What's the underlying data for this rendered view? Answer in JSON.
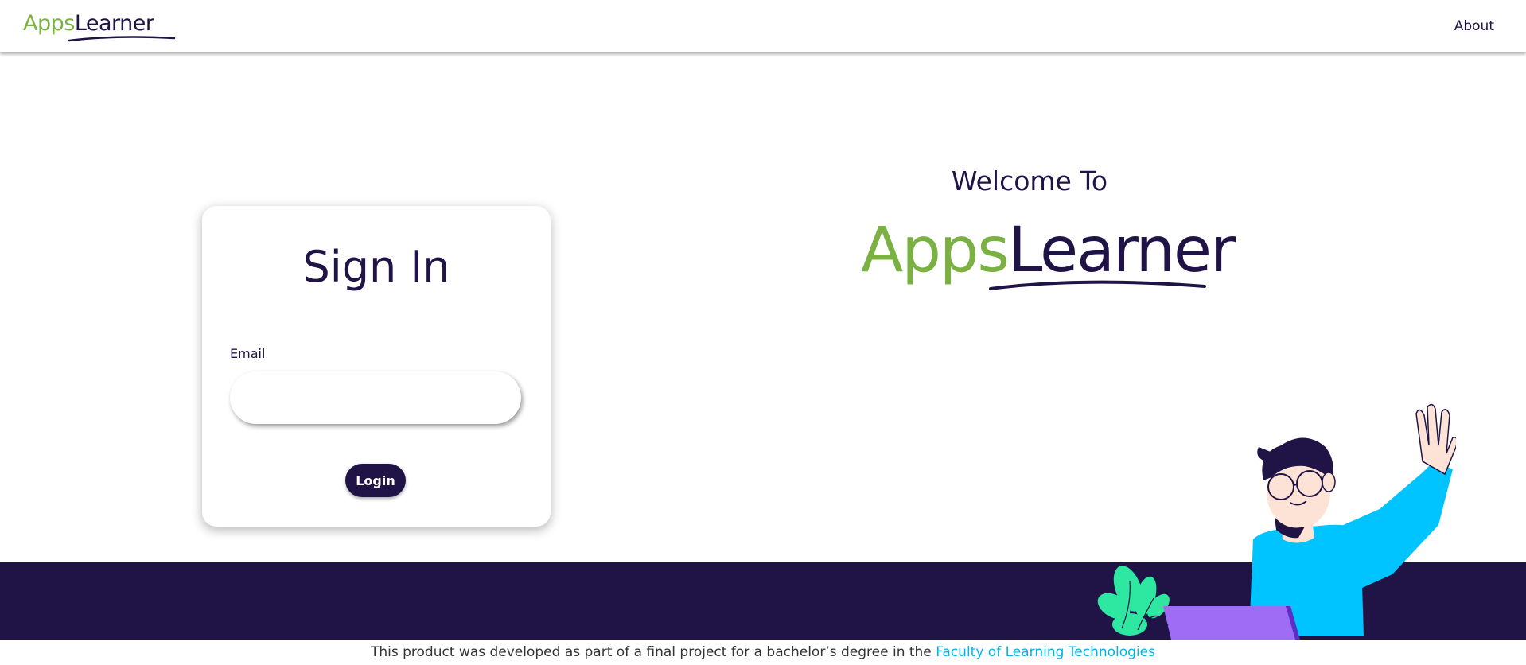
{
  "header": {
    "logo": {
      "part1": "Apps",
      "part2": "Learner"
    },
    "nav": {
      "about_label": "About"
    }
  },
  "signin": {
    "title": "Sign In",
    "email_label": "Email",
    "email_value": "",
    "email_placeholder": "",
    "login_label": "Login"
  },
  "welcome": {
    "heading": "Welcome To",
    "logo": {
      "part1": "Apps",
      "part2": "Learner"
    }
  },
  "footer": {
    "text": "This product was developed as part of a final project for a bachelor’s degree in the ",
    "link_label": "Faculty of Learning Technologies"
  },
  "colors": {
    "brand_green": "#7bb043",
    "brand_navy": "#201446",
    "link_blue": "#00b4e6"
  },
  "icons": {
    "illustration": "waving-student-with-laptop-illustration"
  }
}
